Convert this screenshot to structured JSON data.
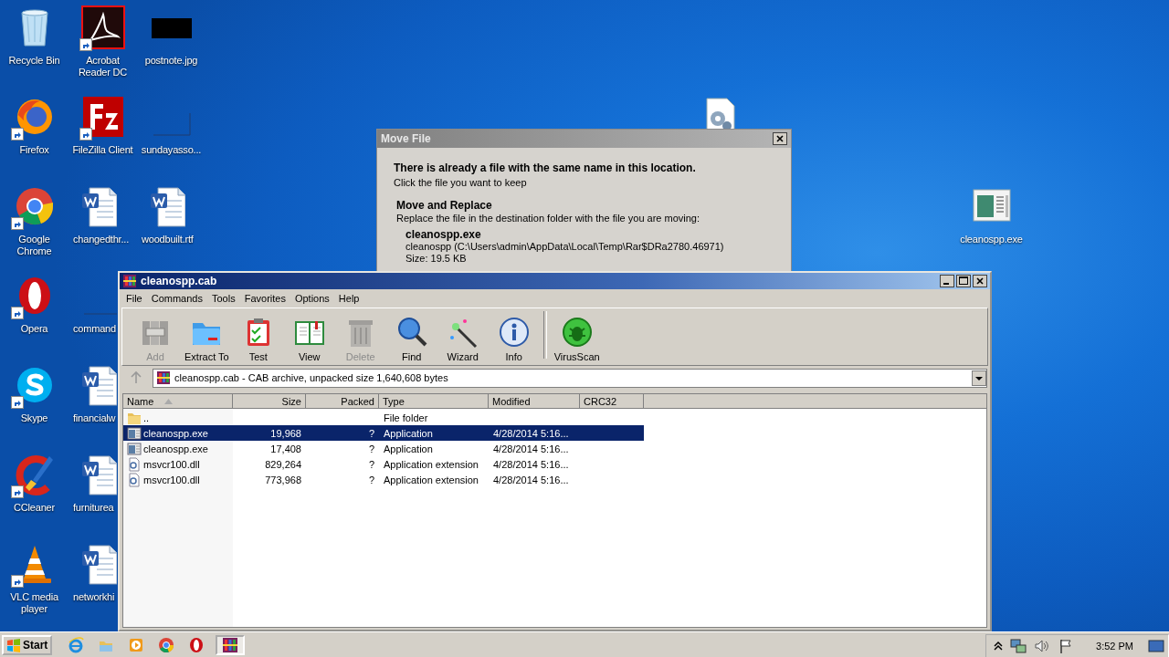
{
  "desktop_icons": [
    {
      "label": "Recycle Bin",
      "kind": "recycle",
      "shortcut": false
    },
    {
      "label": "Firefox",
      "kind": "firefox",
      "shortcut": true
    },
    {
      "label": "Google Chrome",
      "kind": "chrome",
      "shortcut": true
    },
    {
      "label": "Opera",
      "kind": "opera",
      "shortcut": true
    },
    {
      "label": "Skype",
      "kind": "skype",
      "shortcut": true
    },
    {
      "label": "CCleaner",
      "kind": "ccleaner",
      "shortcut": true
    },
    {
      "label": "VLC media player",
      "kind": "vlc",
      "shortcut": true
    },
    {
      "label": "Acrobat Reader DC",
      "kind": "acrobat",
      "shortcut": true
    },
    {
      "label": "FileZilla Client",
      "kind": "filezilla",
      "shortcut": true
    },
    {
      "label": "changedthr...",
      "kind": "word",
      "shortcut": false
    },
    {
      "label": "command",
      "kind": "blank",
      "shortcut": false
    },
    {
      "label": "financialw",
      "kind": "word",
      "shortcut": false
    },
    {
      "label": "furniturea",
      "kind": "word",
      "shortcut": false
    },
    {
      "label": "networkhi",
      "kind": "word",
      "shortcut": false
    },
    {
      "label": "postnote.jpg",
      "kind": "image",
      "shortcut": false
    },
    {
      "label": "sundayasso...",
      "kind": "blank",
      "shortcut": false
    },
    {
      "label": "woodbuilt.rtf",
      "kind": "word",
      "shortcut": false
    }
  ],
  "desktop_icons_right": [
    {
      "kind": "gearfile",
      "shortcut": false
    },
    {
      "label": "cleanospp.exe",
      "kind": "exe",
      "shortcut": false
    }
  ],
  "dialog": {
    "title": "Move File",
    "heading": "There is already a file with the same name in this location.",
    "subtext": "Click the file you want to keep",
    "option_title": "Move and Replace",
    "option_text": "Replace the file in the destination folder with the file you are moving:",
    "file_name": "cleanospp.exe",
    "file_path": "cleanospp (C:\\Users\\admin\\AppData\\Local\\Temp\\Rar$DRa2780.46971)",
    "file_size": "Size: 19.5 KB"
  },
  "window": {
    "title": "cleanospp.cab",
    "menu": [
      "File",
      "Commands",
      "Tools",
      "Favorites",
      "Options",
      "Help"
    ],
    "toolbar": [
      {
        "label": "Add",
        "kind": "add",
        "disabled": true
      },
      {
        "label": "Extract To",
        "kind": "extract",
        "disabled": false
      },
      {
        "label": "Test",
        "kind": "test",
        "disabled": false
      },
      {
        "label": "View",
        "kind": "view",
        "disabled": false
      },
      {
        "label": "Delete",
        "kind": "delete",
        "disabled": true
      },
      {
        "label": "Find",
        "kind": "find",
        "disabled": false
      },
      {
        "label": "Wizard",
        "kind": "wizard",
        "disabled": false
      },
      {
        "label": "Info",
        "kind": "info",
        "disabled": false
      },
      {
        "label": "VirusScan",
        "kind": "virusscan",
        "disabled": false
      }
    ],
    "address": "cleanospp.cab - CAB archive, unpacked size 1,640,608 bytes",
    "columns": [
      {
        "label": "Name",
        "sorted": true
      },
      {
        "label": "Size",
        "sorted": false
      },
      {
        "label": "Packed",
        "sorted": false
      },
      {
        "label": "Type",
        "sorted": false
      },
      {
        "label": "Modified",
        "sorted": false
      },
      {
        "label": "CRC32",
        "sorted": false
      }
    ],
    "rows": [
      {
        "kind": "folder",
        "name": "..",
        "type": "File folder",
        "selected": false
      },
      {
        "kind": "exe",
        "name": "cleanospp.exe",
        "size": "19,968",
        "packed": "?",
        "type": "Application",
        "modified": "4/28/2014 5:16...",
        "selected": true
      },
      {
        "kind": "exe",
        "name": "cleanospp.exe",
        "size": "17,408",
        "packed": "?",
        "type": "Application",
        "modified": "4/28/2014 5:16...",
        "selected": false
      },
      {
        "kind": "dll",
        "name": "msvcr100.dll",
        "size": "829,264",
        "packed": "?",
        "type": "Application extension",
        "modified": "4/28/2014 5:16...",
        "selected": false
      },
      {
        "kind": "dll",
        "name": "msvcr100.dll",
        "size": "773,968",
        "packed": "?",
        "type": "Application extension",
        "modified": "4/28/2014 5:16...",
        "selected": false
      }
    ]
  },
  "taskbar": {
    "start": "Start",
    "apps": [
      {
        "kind": "ie",
        "active": false
      },
      {
        "kind": "explorer",
        "active": false
      },
      {
        "kind": "media",
        "active": false
      },
      {
        "kind": "chrome",
        "active": false
      },
      {
        "kind": "opera",
        "active": false
      },
      {
        "kind": "winrar",
        "active": true
      }
    ],
    "clock": "3:52 PM"
  }
}
